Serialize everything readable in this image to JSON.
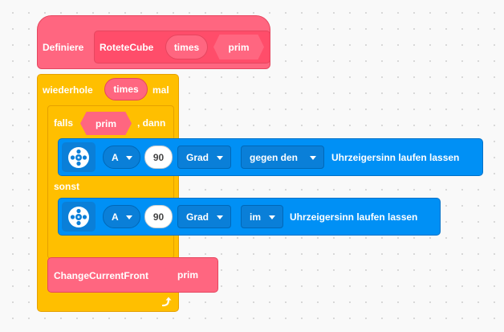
{
  "define_block": {
    "label": "Definiere",
    "proc_name": "RoteteCube",
    "param_times": "times",
    "param_prim": "prim"
  },
  "repeat_block": {
    "prefix": "wiederhole",
    "arg": "times",
    "suffix": "mal"
  },
  "if_block": {
    "if_label": "falls",
    "condition": "prim",
    "then_label": ", dann",
    "else_label": "sonst"
  },
  "motor_block_1": {
    "port": "A",
    "amount": "90",
    "unit": "Grad",
    "direction": "gegen den",
    "text": "Uhrzeigersinn  laufen lassen"
  },
  "motor_block_2": {
    "port": "A",
    "amount": "90",
    "unit": "Grad",
    "direction": "im",
    "text": "Uhrzeigersinn  laufen lassen"
  },
  "call_block": {
    "label": "ChangeCurrentFront",
    "arg": "prim"
  },
  "icons": {
    "motor": "motor-icon",
    "loop": "loop-arrow-icon"
  },
  "colors": {
    "my_blocks": "#ff6680",
    "control": "#ffbf00",
    "motors": "#0090f5"
  }
}
